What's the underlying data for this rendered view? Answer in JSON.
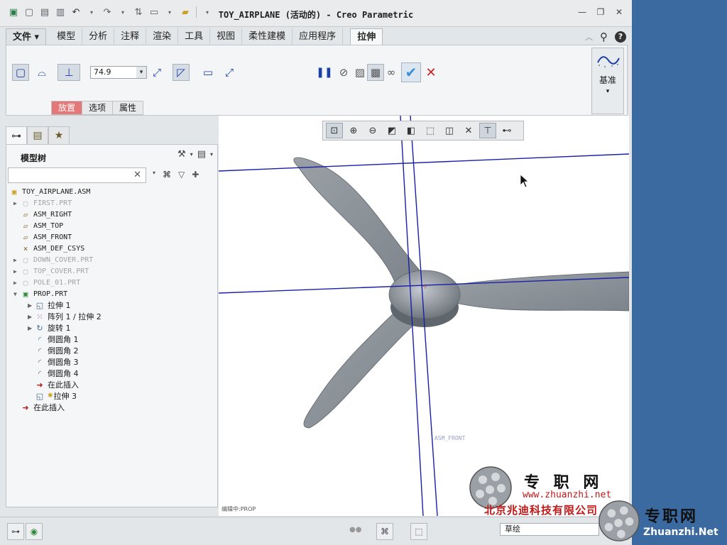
{
  "window": {
    "title": "TOY_AIRPLANE (活动的) - Creo Parametric",
    "controls": [
      "—",
      "❐",
      "✕"
    ]
  },
  "tabs": [
    "文件 ▾",
    "模型",
    "分析",
    "注释",
    "渲染",
    "工具",
    "视图",
    "柔性建模",
    "应用程序",
    "拉伸"
  ],
  "ribbon": {
    "depth_value": "74.9",
    "datum_label": "基准",
    "subtabs": [
      "放置",
      "选项",
      "属性"
    ]
  },
  "model_tree": {
    "title": "模型树",
    "search_placeholder": "",
    "nodes": [
      {
        "label": "TOY_AIRPLANE.ASM",
        "icon": "assembly-icon"
      },
      {
        "label": "FIRST.PRT",
        "icon": "part-icon"
      },
      {
        "label": "ASM_RIGHT",
        "icon": "datum-plane-icon"
      },
      {
        "label": "ASM_TOP",
        "icon": "datum-plane-icon"
      },
      {
        "label": "ASM_FRONT",
        "icon": "datum-plane-icon"
      },
      {
        "label": "ASM_DEF_CSYS",
        "icon": "csys-icon"
      },
      {
        "label": "DOWN_COVER.PRT",
        "icon": "part-icon"
      },
      {
        "label": "TOP_COVER.PRT",
        "icon": "part-icon"
      },
      {
        "label": "POLE_01.PRT",
        "icon": "part-icon"
      },
      {
        "label": "PROP.PRT",
        "icon": "part-icon"
      },
      {
        "label": "拉伸 1",
        "icon": "extrude-icon"
      },
      {
        "label": "阵列 1 / 拉伸 2",
        "icon": "pattern-icon"
      },
      {
        "label": "旋转 1",
        "icon": "revolve-icon"
      },
      {
        "label": "倒圆角 1",
        "icon": "round-icon"
      },
      {
        "label": "倒圆角 2",
        "icon": "round-icon"
      },
      {
        "label": "倒圆角 3",
        "icon": "round-icon"
      },
      {
        "label": "倒圆角 4",
        "icon": "round-icon"
      },
      {
        "label": "在此插入",
        "icon": "insert-arrow-icon"
      },
      {
        "label": "拉伸 3",
        "icon": "extrude-icon"
      },
      {
        "label": "在此插入",
        "icon": "insert-arrow-icon"
      }
    ],
    "status": "编辑中:PROP"
  },
  "viewport": {
    "datum_label": "ASM_FRONT"
  },
  "bottom": {
    "filter_value": "草绘"
  },
  "watermark": {
    "site_name": "专 职 网",
    "url": "www.zhuanzhi.net",
    "company": "北京兆迪科技有限公司",
    "brand": "专职网",
    "brand_url": "Zhuanzhi.Net"
  },
  "colors": {
    "accent_red": "#e47878",
    "datum_blue": "#1a1fa8",
    "model_gray": "#8a9198",
    "desktop": "#3b6aa0"
  }
}
